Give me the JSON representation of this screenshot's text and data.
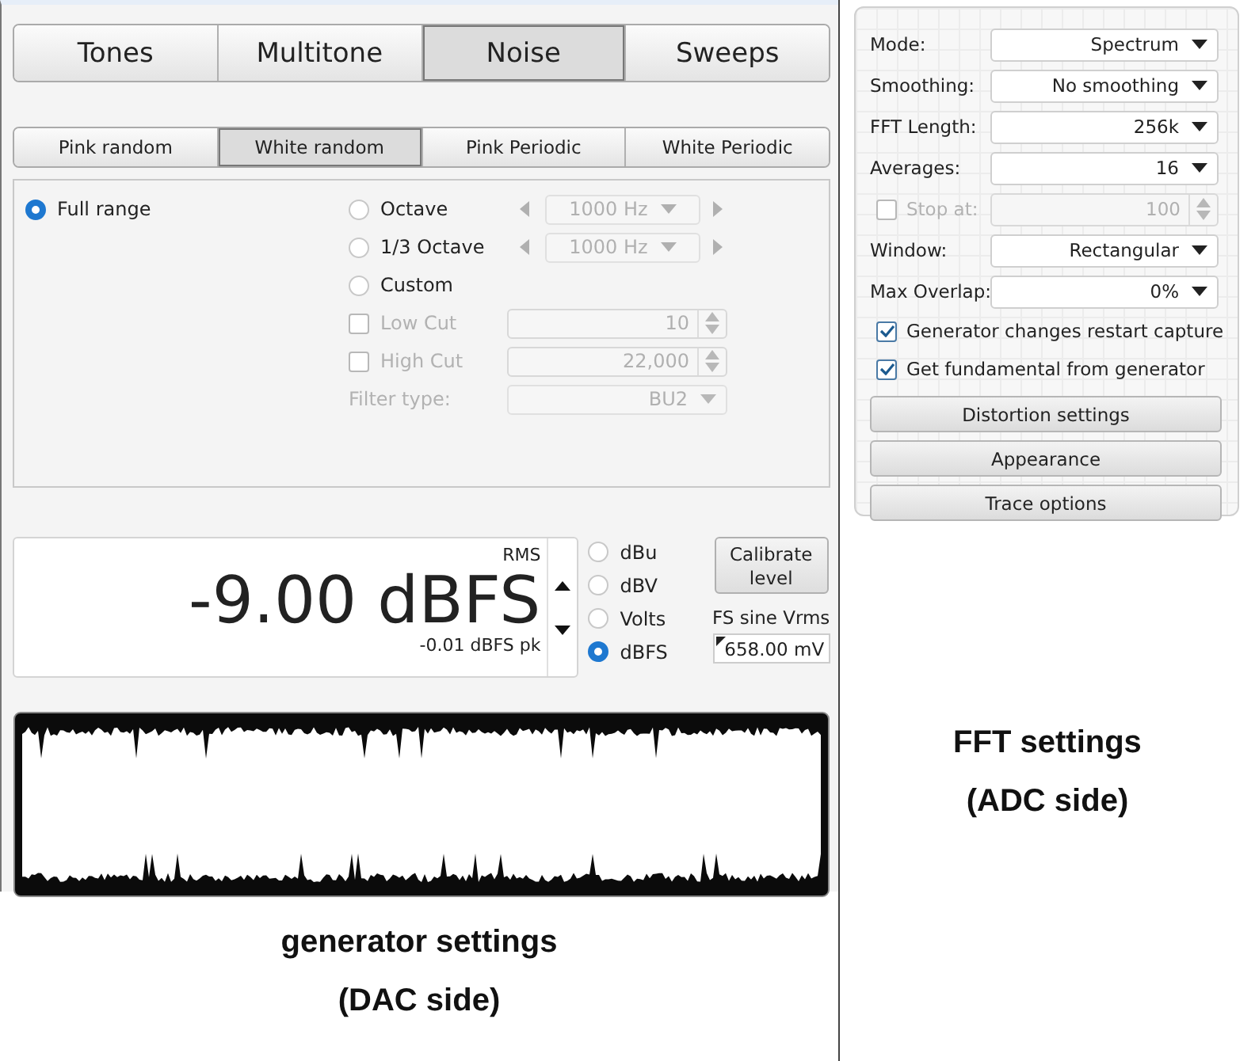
{
  "generator": {
    "tabs": [
      {
        "label": "Tones",
        "selected": false
      },
      {
        "label": "Multitone",
        "selected": false
      },
      {
        "label": "Noise",
        "selected": true
      },
      {
        "label": "Sweeps",
        "selected": false
      }
    ],
    "noise_types": [
      {
        "label": "Pink random",
        "selected": false
      },
      {
        "label": "White random",
        "selected": true
      },
      {
        "label": "Pink Periodic",
        "selected": false
      },
      {
        "label": "White Periodic",
        "selected": false
      }
    ],
    "range_options": [
      {
        "label": "Full range",
        "selected": true
      },
      {
        "label": "Octave",
        "selected": false,
        "frequency": {
          "value": "1000 Hz",
          "disabled": true
        }
      },
      {
        "label": "1/3 Octave",
        "selected": false,
        "frequency": {
          "value": "1000 Hz",
          "disabled": true
        }
      },
      {
        "label": "Custom",
        "selected": false
      }
    ],
    "cuts": [
      {
        "label": "Low Cut",
        "checked": false,
        "disabled": true,
        "value": "10"
      },
      {
        "label": "High Cut",
        "checked": false,
        "disabled": true,
        "value": "22,000"
      }
    ],
    "filter_type": {
      "label": "Filter type:",
      "value": "BU2",
      "disabled": true
    },
    "level": {
      "mode_label": "RMS",
      "value": "-9.00 dBFS",
      "peak": "-0.01 dBFS pk"
    },
    "units": [
      {
        "label": "dBu",
        "selected": false
      },
      {
        "label": "dBV",
        "selected": false
      },
      {
        "label": "Volts",
        "selected": false
      },
      {
        "label": "dBFS",
        "selected": true
      }
    ],
    "calibrate_button": "Calibrate level",
    "fs_label": "FS sine Vrms",
    "fs_value": "658.00 mV"
  },
  "fft": {
    "settings": [
      {
        "kind": "dropdown",
        "label": "Mode:",
        "value": "Spectrum"
      },
      {
        "kind": "dropdown",
        "label": "Smoothing:",
        "value": "No smoothing"
      },
      {
        "kind": "dropdown",
        "label": "FFT Length:",
        "value": "256k"
      },
      {
        "kind": "dropdown",
        "label": "Averages:",
        "value": "16"
      },
      {
        "kind": "spinner",
        "label": "Stop at:",
        "value": "100",
        "checked": false,
        "disabled": true
      },
      {
        "kind": "dropdown",
        "label": "Window:",
        "value": "Rectangular"
      },
      {
        "kind": "dropdown",
        "label": "Max Overlap:",
        "value": "0%"
      }
    ],
    "options": [
      {
        "label": "Generator changes restart capture",
        "checked": true
      },
      {
        "label": "Get fundamental from generator",
        "checked": true
      }
    ],
    "buttons": [
      "Distortion settings",
      "Appearance",
      "Trace options"
    ]
  },
  "captions": [
    {
      "title": "generator settings",
      "subtitle": "(DAC side)"
    },
    {
      "title": "FFT settings",
      "subtitle": "(ADC side)"
    }
  ]
}
